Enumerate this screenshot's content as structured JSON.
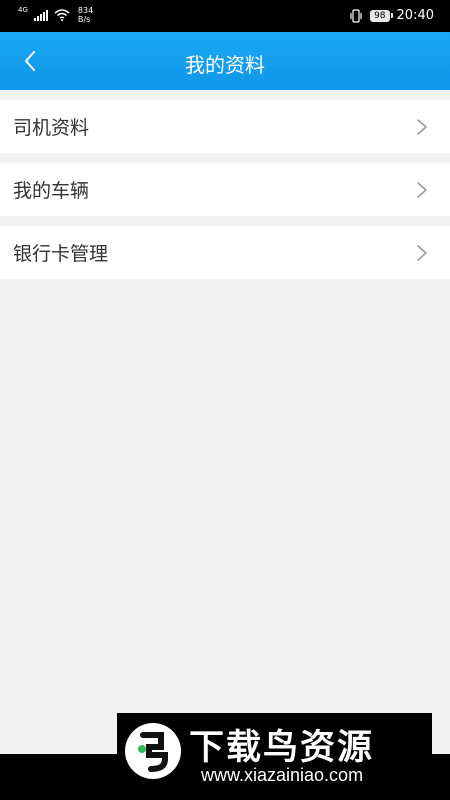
{
  "status_bar": {
    "network_type": "4G",
    "speed_value": "834",
    "speed_unit": "B/s",
    "battery": "98",
    "time": "20:40"
  },
  "header": {
    "title": "我的资料"
  },
  "menu": {
    "items": [
      {
        "label": "司机资料"
      },
      {
        "label": "我的车辆"
      },
      {
        "label": "银行卡管理"
      }
    ]
  },
  "watermark": {
    "title": "下载鸟资源",
    "url": "www.xiazainiao.com"
  },
  "colors": {
    "header_blue": "#1296e8",
    "background": "#f2f2f2"
  }
}
